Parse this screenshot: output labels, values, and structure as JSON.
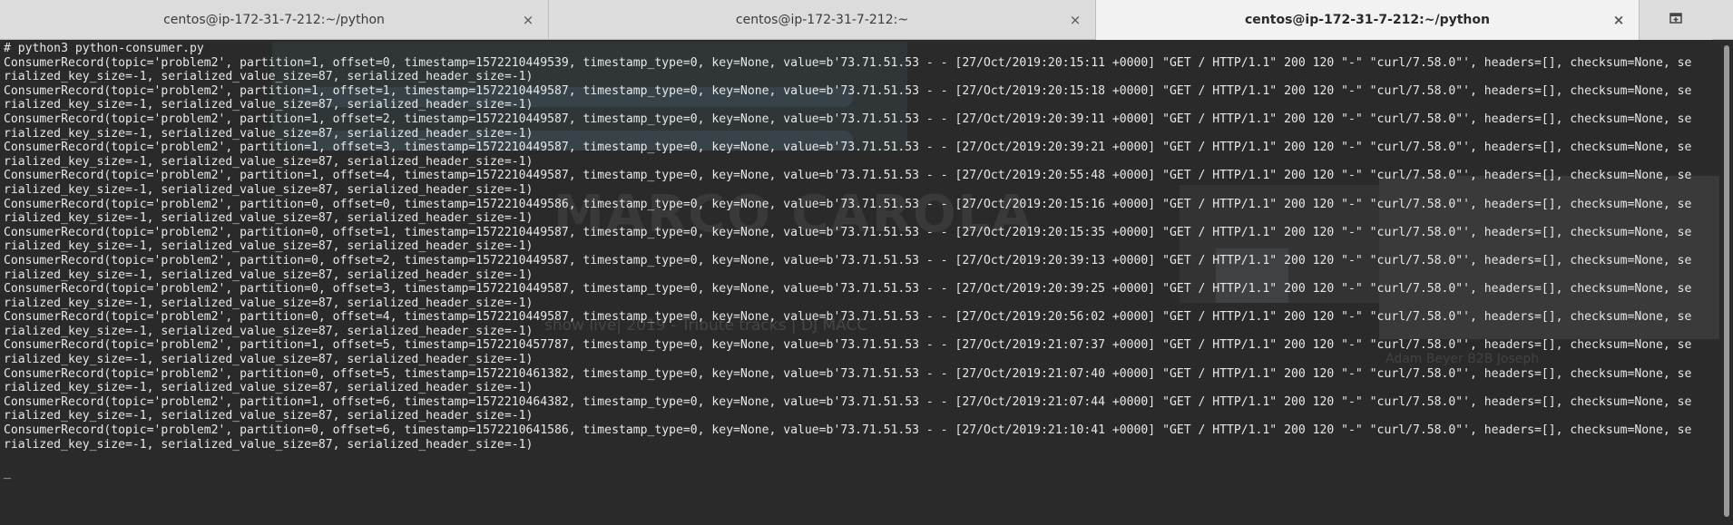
{
  "tabs": [
    {
      "label": "centos@ip-172-31-7-212:~/python",
      "active": false
    },
    {
      "label": "centos@ip-172-31-7-212:~",
      "active": false
    },
    {
      "label": "centos@ip-172-31-7-212:~/python",
      "active": true
    }
  ],
  "icons": {
    "tab_close": "×",
    "new_tab": "new-tab-icon"
  },
  "terminal": {
    "lines": [
      "# python3 python-consumer.py",
      "ConsumerRecord(topic='problem2', partition=1, offset=0, timestamp=1572210449539, timestamp_type=0, key=None, value=b'73.71.51.53 - - [27/Oct/2019:20:15:11 +0000] \"GET / HTTP/1.1\" 200 120 \"-\" \"curl/7.58.0\"', headers=[], checksum=None, se",
      "rialized_key_size=-1, serialized_value_size=87, serialized_header_size=-1)",
      "ConsumerRecord(topic='problem2', partition=1, offset=1, timestamp=1572210449587, timestamp_type=0, key=None, value=b'73.71.51.53 - - [27/Oct/2019:20:15:18 +0000] \"GET / HTTP/1.1\" 200 120 \"-\" \"curl/7.58.0\"', headers=[], checksum=None, se",
      "rialized_key_size=-1, serialized_value_size=87, serialized_header_size=-1)",
      "ConsumerRecord(topic='problem2', partition=1, offset=2, timestamp=1572210449587, timestamp_type=0, key=None, value=b'73.71.51.53 - - [27/Oct/2019:20:39:11 +0000] \"GET / HTTP/1.1\" 200 120 \"-\" \"curl/7.58.0\"', headers=[], checksum=None, se",
      "rialized_key_size=-1, serialized_value_size=87, serialized_header_size=-1)",
      "ConsumerRecord(topic='problem2', partition=1, offset=3, timestamp=1572210449587, timestamp_type=0, key=None, value=b'73.71.51.53 - - [27/Oct/2019:20:39:21 +0000] \"GET / HTTP/1.1\" 200 120 \"-\" \"curl/7.58.0\"', headers=[], checksum=None, se",
      "rialized_key_size=-1, serialized_value_size=87, serialized_header_size=-1)",
      "ConsumerRecord(topic='problem2', partition=1, offset=4, timestamp=1572210449587, timestamp_type=0, key=None, value=b'73.71.51.53 - - [27/Oct/2019:20:55:48 +0000] \"GET / HTTP/1.1\" 200 120 \"-\" \"curl/7.58.0\"', headers=[], checksum=None, se",
      "rialized_key_size=-1, serialized_value_size=87, serialized_header_size=-1)",
      "ConsumerRecord(topic='problem2', partition=0, offset=0, timestamp=1572210449586, timestamp_type=0, key=None, value=b'73.71.51.53 - - [27/Oct/2019:20:15:16 +0000] \"GET / HTTP/1.1\" 200 120 \"-\" \"curl/7.58.0\"', headers=[], checksum=None, se",
      "rialized_key_size=-1, serialized_value_size=87, serialized_header_size=-1)",
      "ConsumerRecord(topic='problem2', partition=0, offset=1, timestamp=1572210449587, timestamp_type=0, key=None, value=b'73.71.51.53 - - [27/Oct/2019:20:15:35 +0000] \"GET / HTTP/1.1\" 200 120 \"-\" \"curl/7.58.0\"', headers=[], checksum=None, se",
      "rialized_key_size=-1, serialized_value_size=87, serialized_header_size=-1)",
      "ConsumerRecord(topic='problem2', partition=0, offset=2, timestamp=1572210449587, timestamp_type=0, key=None, value=b'73.71.51.53 - - [27/Oct/2019:20:39:13 +0000] \"GET / HTTP/1.1\" 200 120 \"-\" \"curl/7.58.0\"', headers=[], checksum=None, se",
      "rialized_key_size=-1, serialized_value_size=87, serialized_header_size=-1)",
      "ConsumerRecord(topic='problem2', partition=0, offset=3, timestamp=1572210449587, timestamp_type=0, key=None, value=b'73.71.51.53 - - [27/Oct/2019:20:39:25 +0000] \"GET / HTTP/1.1\" 200 120 \"-\" \"curl/7.58.0\"', headers=[], checksum=None, se",
      "rialized_key_size=-1, serialized_value_size=87, serialized_header_size=-1)",
      "ConsumerRecord(topic='problem2', partition=0, offset=4, timestamp=1572210449587, timestamp_type=0, key=None, value=b'73.71.51.53 - - [27/Oct/2019:20:56:02 +0000] \"GET / HTTP/1.1\" 200 120 \"-\" \"curl/7.58.0\"', headers=[], checksum=None, se",
      "rialized_key_size=-1, serialized_value_size=87, serialized_header_size=-1)",
      "ConsumerRecord(topic='problem2', partition=1, offset=5, timestamp=1572210457787, timestamp_type=0, key=None, value=b'73.71.51.53 - - [27/Oct/2019:21:07:37 +0000] \"GET / HTTP/1.1\" 200 120 \"-\" \"curl/7.58.0\"', headers=[], checksum=None, se",
      "rialized_key_size=-1, serialized_value_size=87, serialized_header_size=-1)",
      "ConsumerRecord(topic='problem2', partition=0, offset=5, timestamp=1572210461382, timestamp_type=0, key=None, value=b'73.71.51.53 - - [27/Oct/2019:21:07:40 +0000] \"GET / HTTP/1.1\" 200 120 \"-\" \"curl/7.58.0\"', headers=[], checksum=None, se",
      "rialized_key_size=-1, serialized_value_size=87, serialized_header_size=-1)",
      "ConsumerRecord(topic='problem2', partition=1, offset=6, timestamp=1572210464382, timestamp_type=0, key=None, value=b'73.71.51.53 - - [27/Oct/2019:21:07:44 +0000] \"GET / HTTP/1.1\" 200 120 \"-\" \"curl/7.58.0\"', headers=[], checksum=None, se",
      "rialized_key_size=-1, serialized_value_size=87, serialized_header_size=-1)",
      "ConsumerRecord(topic='problem2', partition=0, offset=6, timestamp=1572210641586, timestamp_type=0, key=None, value=b'73.71.51.53 - - [27/Oct/2019:21:10:41 +0000] \"GET / HTTP/1.1\" 200 120 \"-\" \"curl/7.58.0\"', headers=[], checksum=None, se",
      "rialized_key_size=-1, serialized_value_size=87, serialized_header_size=-1)",
      ""
    ],
    "prompt_cursor": "_"
  },
  "background": {
    "faded_title": "MARCO CAROLA",
    "faded_subtitle": "show live| 2019 - Tribute tracks | DJ MACC",
    "faded_sidebar": "Adam Beyer B2B Joseph"
  },
  "colors": {
    "tabbar_bg": "#dcdcdc",
    "tab_active_bg": "#f2f2f2",
    "terminal_bg": "#2a2a2a",
    "terminal_fg": "#e8e8e8"
  }
}
